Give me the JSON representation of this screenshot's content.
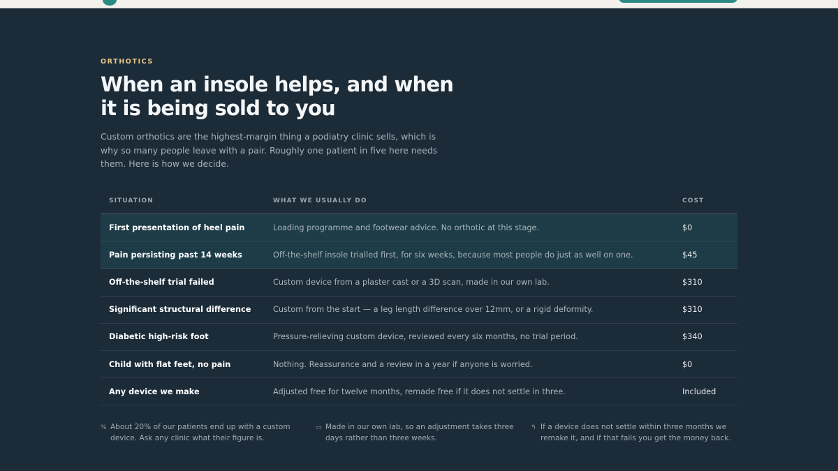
{
  "eyebrow": "ORTHOTICS",
  "headline": "When an insole helps, and when it is being sold to you",
  "intro": "Custom orthotics are the highest-margin thing a podiatry clinic sells, which is why so many people leave with a pair. Roughly one patient in five here needs them. Here is how we decide.",
  "table": {
    "headers": {
      "situation": "SITUATION",
      "action": "WHAT WE USUALLY DO",
      "cost": "COST"
    },
    "rows": [
      {
        "situation": "First presentation of heel pain",
        "action": "Loading programme and footwear advice. No orthotic at this stage.",
        "cost": "$0",
        "highlighted": true
      },
      {
        "situation": "Pain persisting past 14 weeks",
        "action": "Off-the-shelf insole trialled first, for six weeks, because most people do just as well on one.",
        "cost": "$45",
        "highlighted": true
      },
      {
        "situation": "Off-the-shelf trial failed",
        "action": "Custom device from a plaster cast or a 3D scan, made in our own lab.",
        "cost": "$310",
        "highlighted": false
      },
      {
        "situation": "Significant structural difference",
        "action": "Custom from the start — a leg length difference over 12mm, or a rigid deformity.",
        "cost": "$310",
        "highlighted": false
      },
      {
        "situation": "Diabetic high-risk foot",
        "action": "Pressure-relieving custom device, reviewed every six months, no trial period.",
        "cost": "$340",
        "highlighted": false
      },
      {
        "situation": "Child with flat feet, no pain",
        "action": "Nothing. Reassurance and a review in a year if anyone is worried.",
        "cost": "$0",
        "highlighted": false
      },
      {
        "situation": "Any device we make",
        "action": "Adjusted free for twelve months, remade free if it does not settle in three.",
        "cost": "Included",
        "highlighted": false
      }
    ]
  },
  "notes": [
    {
      "icon": "percent-icon",
      "glyph": "%",
      "text": "About 20% of our patients end up with a custom device. Ask any clinic what their figure is."
    },
    {
      "icon": "folder-icon",
      "glyph": "▭",
      "text": "Made in our own lab, so an adjustment takes three days rather than three weeks."
    },
    {
      "icon": "return-arrow-icon",
      "glyph": "↰",
      "text": "If a device does not settle within three months we remake it, and if that fails you get the money back."
    }
  ],
  "colors": {
    "background": "#1c2b38",
    "accent": "#2a8a85",
    "eyebrow": "#e8c98a",
    "highlight_row": "#1e3c47"
  }
}
